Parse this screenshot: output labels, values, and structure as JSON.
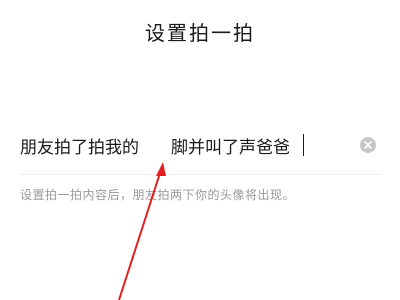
{
  "header": {
    "title": "设置拍一拍"
  },
  "pat_setting": {
    "prefix": "朋友拍了拍我的",
    "value": "脚并叫了声爸爸",
    "clear_icon": "clear-icon"
  },
  "hint": "设置拍一拍内容后，朋友拍两下你的头像将出现。",
  "annotation": {
    "color": "#e02020"
  }
}
